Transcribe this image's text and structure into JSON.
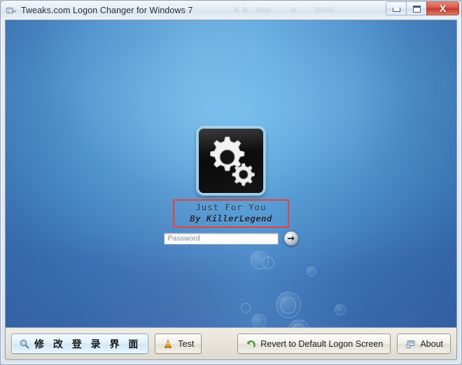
{
  "window": {
    "title": "Tweaks.com Logon Changer for Windows 7",
    "title_icon": "app-window-icon",
    "controls": {
      "minimize": {
        "icon": "minimize-icon",
        "label": ""
      },
      "maximize": {
        "icon": "maximize-icon",
        "label": ""
      },
      "close": {
        "icon": "close-icon",
        "label": "X"
      }
    }
  },
  "preview": {
    "name": "logon-screen-preview",
    "avatar_icon": "gears-icon",
    "highlight_color": "#e8433a",
    "user_line1": "Just For You",
    "user_line2": "By KillerLegend",
    "password": {
      "value": "",
      "placeholder": "Password"
    },
    "submit_icon": "arrow-right-icon"
  },
  "toolbar": {
    "change_logon_label": "修 改 登 录 界 面",
    "change_logon_icon": "magnifier-icon",
    "test_label": "Test",
    "test_icon": "traffic-cone-icon",
    "revert_label": "Revert to Default Logon Screen",
    "revert_icon": "undo-arrow-icon",
    "about_label": "About",
    "about_icon": "about-monitor-icon"
  },
  "colors": {
    "wallpaper_top": "#4a86c4",
    "wallpaper_bottom": "#3a6aae",
    "wallpaper_glow": "#78beeb",
    "close_button": "#c43a2c",
    "highlight": "#e8433a",
    "toolbar_bg": "#e7e3da"
  }
}
